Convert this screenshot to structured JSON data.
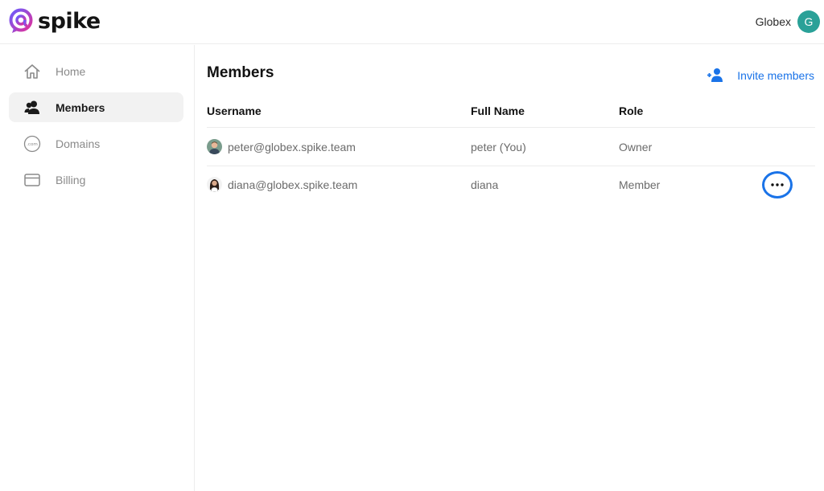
{
  "app": {
    "logo_text": "spike",
    "brand_color": "#8a2be2"
  },
  "header": {
    "account_name": "Globex",
    "avatar_initial": "G",
    "avatar_color": "#2aa198"
  },
  "sidebar": {
    "items": [
      {
        "label": "Home",
        "icon": "home-icon",
        "active": false
      },
      {
        "label": "Members",
        "icon": "members-icon",
        "active": true
      },
      {
        "label": "Domains",
        "icon": "domain-icon",
        "active": false
      },
      {
        "label": "Billing",
        "icon": "credit-card-icon",
        "active": false
      }
    ]
  },
  "main": {
    "title": "Members",
    "invite_label": "Invite members",
    "accent_color": "#1a73e8",
    "table": {
      "columns": [
        "Username",
        "Full Name",
        "Role"
      ],
      "rows": [
        {
          "username": "peter@globex.spike.team",
          "full_name": "peter (You)",
          "role": "Owner"
        },
        {
          "username": "diana@globex.spike.team",
          "full_name": "diana",
          "role": "Member"
        }
      ]
    }
  }
}
